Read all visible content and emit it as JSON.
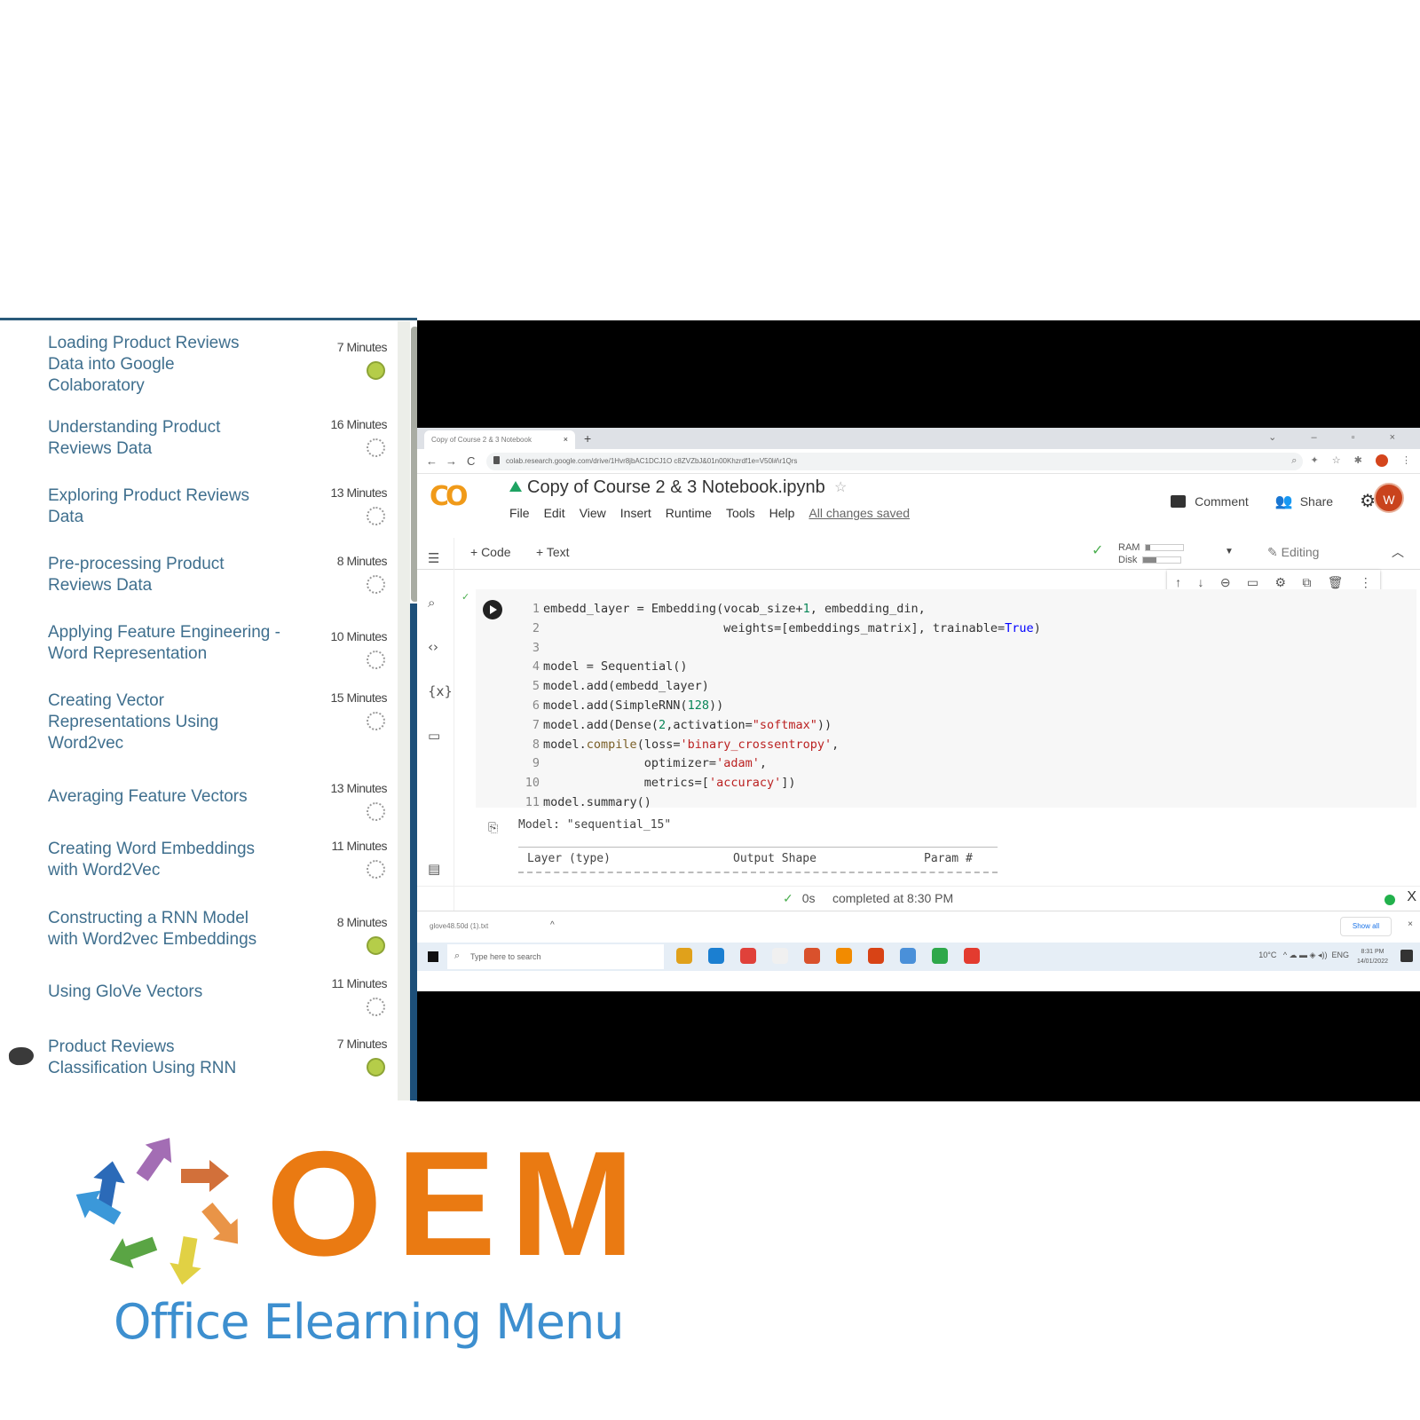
{
  "sidebar": {
    "lessons": [
      {
        "title": "Loading Product Reviews Data into Google Colaboratory",
        "duration": "7 Minutes",
        "status": "completed"
      },
      {
        "title": "Understanding Product Reviews Data",
        "duration": "16 Minutes",
        "status": "not-started"
      },
      {
        "title": "Exploring Product Reviews Data",
        "duration": "13 Minutes",
        "status": "not-started"
      },
      {
        "title": "Pre-processing Product Reviews Data",
        "duration": "8 Minutes",
        "status": "not-started"
      },
      {
        "title": "Applying Feature Engineering - Word Representation",
        "duration": "10 Minutes",
        "status": "not-started"
      },
      {
        "title": "Creating Vector Representations Using Word2vec",
        "duration": "15 Minutes",
        "status": "not-started"
      },
      {
        "title": "Averaging Feature Vectors",
        "duration": "13 Minutes",
        "status": "not-started"
      },
      {
        "title": "Creating Word Embeddings with Word2Vec",
        "duration": "11 Minutes",
        "status": "not-started"
      },
      {
        "title": "Constructing a RNN Model with Word2vec Embeddings",
        "duration": "8 Minutes",
        "status": "completed"
      },
      {
        "title": "Using GloVe Vectors",
        "duration": "11 Minutes",
        "status": "not-started"
      },
      {
        "title": "Product Reviews Classification Using RNN",
        "duration": "7 Minutes",
        "status": "completed",
        "current": true
      }
    ],
    "colors": {
      "title": "#3f6f8e",
      "completed": "#b5cd49"
    }
  },
  "browser": {
    "tab_title": "Copy of Course 2 & 3 Notebook",
    "tab_close": "×",
    "new_tab": "+",
    "window_controls": "⌄ – ▫ ×",
    "url": "colab.research.google.com/drive/1Hvr8jbAC1DCJ1O c8ZVZbJ&01n00Khzrdf1e=V50l#\\r1Qrs",
    "nav": {
      "back": "←",
      "forward": "→",
      "reload": "C"
    }
  },
  "colab": {
    "logo": "CO",
    "doc_title": "Copy of Course 2 & 3 Notebook.ipynb",
    "star": "☆",
    "menu": [
      "File",
      "Edit",
      "View",
      "Insert",
      "Runtime",
      "Tools",
      "Help"
    ],
    "save_status": "All changes saved",
    "comment_label": "Comment",
    "share_label": "Share",
    "avatar_initial": "W",
    "add_code": "+ Code",
    "add_text": "+ Text",
    "ram_label": "RAM",
    "disk_label": "Disk",
    "ram_usage": 0.1,
    "disk_usage": 0.35,
    "editing_label": "Editing",
    "cell_toolbar": [
      "↑",
      "↓",
      "⊖",
      "▭",
      "⚙",
      "⧉",
      "🗑",
      "⋮"
    ],
    "code_lines": [
      {
        "n": "1",
        "text": "embedd_layer = Embedding(vocab_size+1, embedding_din,"
      },
      {
        "n": "2",
        "text": "                         weights=[embeddings_matrix], trainable=True)"
      },
      {
        "n": "3",
        "text": ""
      },
      {
        "n": "4",
        "text": "model = Sequential()"
      },
      {
        "n": "5",
        "text": "model.add(embedd_layer)"
      },
      {
        "n": "6",
        "text": "model.add(SimpleRNN(128))"
      },
      {
        "n": "7",
        "text": "model.add(Dense(2,activation=\"softmax\"))"
      },
      {
        "n": "8",
        "text": "model.compile(loss='binary_crossentropy',"
      },
      {
        "n": "9",
        "text": "              optimizer='adam',"
      },
      {
        "n": "10",
        "text": "              metrics=['accuracy'])"
      },
      {
        "n": "11",
        "text": "model.summary()"
      }
    ],
    "output": {
      "model_line": "Model: \"sequential_15\"",
      "col_layer": "Layer (type)",
      "col_shape": "Output Shape",
      "col_params": "Param #"
    },
    "status": {
      "duration": "0s",
      "completed": "completed at 8:30 PM",
      "close": "X"
    }
  },
  "downloads": {
    "item": "glove48.50d (1).txt",
    "show_all": "Show all",
    "close": "×"
  },
  "taskbar": {
    "search_placeholder": "Type here to search",
    "apps": [
      "#e0a11b",
      "#1b7fd1",
      "#e0413a",
      "#f0f0f0",
      "#d9512c",
      "#f28b00",
      "#d84315",
      "#4a90d9",
      "#2ea84a",
      "#e33b2f"
    ],
    "temperature": "10°C",
    "lang": "ENG",
    "time": "8:31 PM",
    "date": "14/01/2022"
  },
  "logo": {
    "letters": "OEM",
    "tagline": "Office Elearning Menu",
    "arrow_colors": [
      "#2b6ab8",
      "#a36db4",
      "#d2703a",
      "#e99447",
      "#e1d144",
      "#5aa544",
      "#3b98d9"
    ],
    "brand_orange": "#ea7a12",
    "brand_blue": "#3d8fcf"
  }
}
